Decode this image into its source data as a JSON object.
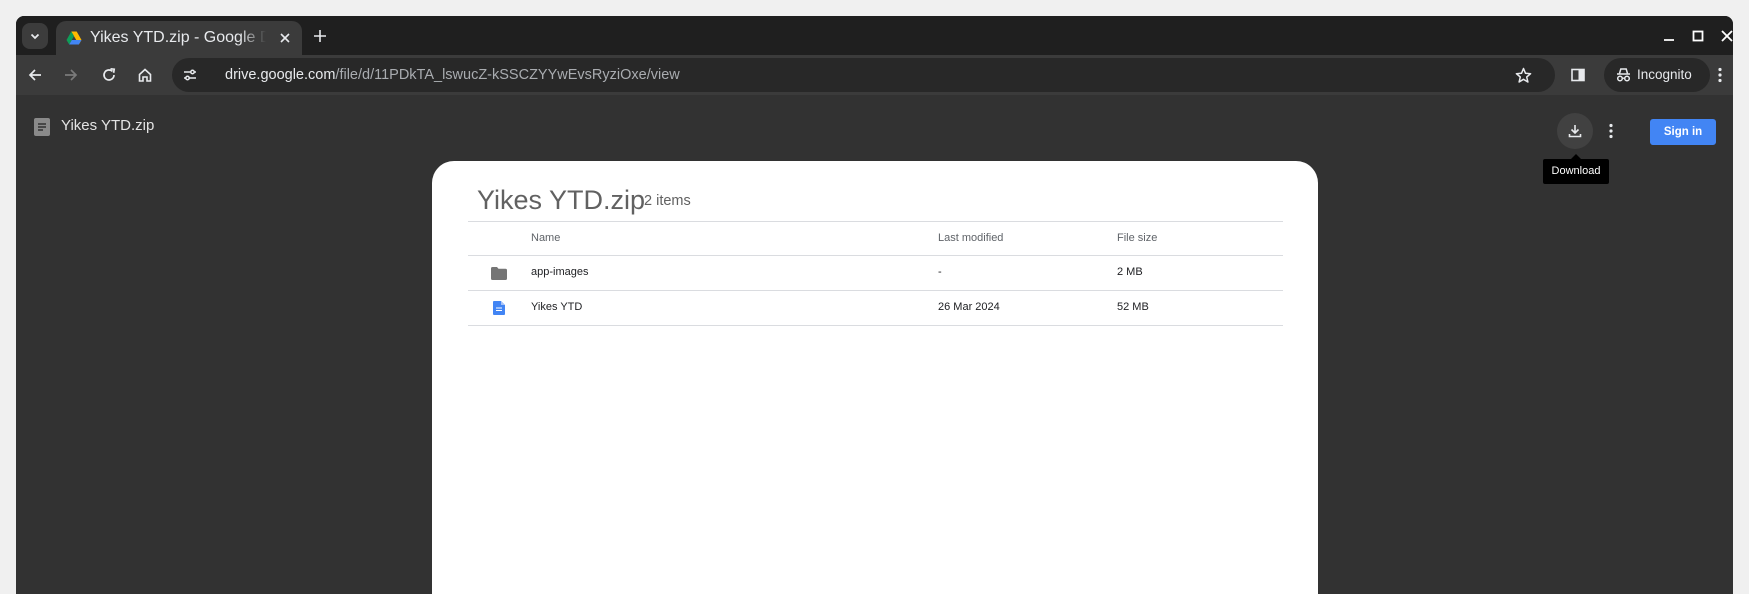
{
  "tab": {
    "title": "Yikes YTD.zip - Google Drive",
    "favicon": "google-drive-icon"
  },
  "address_bar": {
    "host": "drive.google.com",
    "path": "/file/d/11PDkTA_lswucZ-kSSCZYYwEvsRyziOxe/view"
  },
  "incognito": {
    "label": "Incognito"
  },
  "drive_header": {
    "file_title": "Yikes YTD.zip",
    "sign_in_label": "Sign in",
    "download_tooltip": "Download"
  },
  "archive": {
    "title": "Yikes YTD.zip",
    "item_count": "2 items",
    "columns": {
      "name": "Name",
      "last_modified": "Last modified",
      "file_size": "File size"
    },
    "rows": [
      {
        "icon": "folder-icon",
        "name": "app-images",
        "last_modified": "-",
        "file_size": "2 MB"
      },
      {
        "icon": "document-icon",
        "name": "Yikes YTD",
        "last_modified": "26 Mar 2024",
        "file_size": "52 MB"
      }
    ]
  },
  "colors": {
    "sign_in_button": "#4285f4",
    "browser_frame": "#1f1f1f",
    "toolbar": "#3b3b3b",
    "page_background": "#323232",
    "document_icon": "#4285f4",
    "folder_icon": "#757575"
  }
}
